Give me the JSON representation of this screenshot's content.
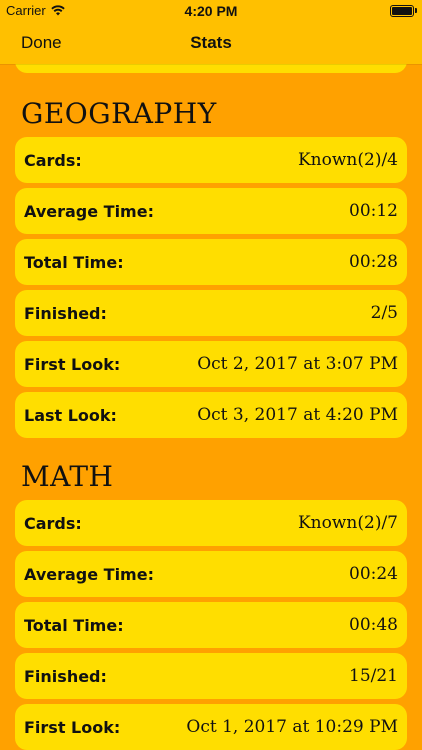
{
  "status_bar": {
    "carrier": "Carrier",
    "time": "4:20 PM"
  },
  "nav": {
    "done_label": "Done",
    "title": "Stats"
  },
  "sections": [
    {
      "title": "GEOGRAPHY",
      "rows": [
        {
          "label": "Cards:",
          "value": "Known(2)/4"
        },
        {
          "label": "Average Time:",
          "value": "00:12"
        },
        {
          "label": "Total Time:",
          "value": "00:28"
        },
        {
          "label": "Finished:",
          "value": "2/5"
        },
        {
          "label": "First Look:",
          "value": "Oct 2, 2017 at 3:07 PM"
        },
        {
          "label": "Last Look:",
          "value": "Oct 3, 2017 at 4:20 PM"
        }
      ]
    },
    {
      "title": "MATH",
      "rows": [
        {
          "label": "Cards:",
          "value": "Known(2)/7"
        },
        {
          "label": "Average Time:",
          "value": "00:24"
        },
        {
          "label": "Total Time:",
          "value": "00:48"
        },
        {
          "label": "Finished:",
          "value": "15/21"
        },
        {
          "label": "First Look:",
          "value": "Oct 1, 2017 at 10:29 PM"
        }
      ]
    }
  ],
  "colors": {
    "background": "#FFA100",
    "bar": "#FFC000",
    "card": "#FFDE00"
  }
}
